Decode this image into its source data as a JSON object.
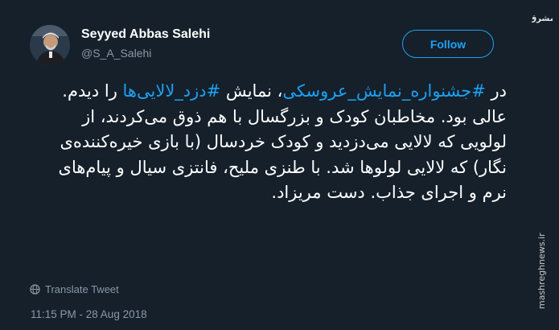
{
  "user": {
    "name": "Seyyed Abbas Salehi",
    "handle": "@S_A_Salehi"
  },
  "follow_button": {
    "label": "Follow"
  },
  "tweet": {
    "t1": "در ",
    "h1": "#جشنواره_نمایش_عروسکی",
    "t2": "، نمایش ",
    "h2": "#دزد_لالایی‌ها",
    "t3": " را دیدم. عالی بود. مخاطبان کودک و بزرگسال با هم ذوق می‌کردند، از لولویی که لالایی می‌دزدید و کودک خردسال (با بازی خیره‌کننده‌ی نگار) که  لالایی لولوها شد. با طنزی ملیح، فانتزی سیال و پیام‌های نرم و اجرای جذاب. دست مریزاد."
  },
  "translate_label": "Translate Tweet",
  "timestamp": "11:15 PM - 28 Aug 2018",
  "watermark": {
    "logo_text": "مشرق",
    "url_text": "mashreghnews.ir"
  },
  "colors": {
    "background": "#15202b",
    "accent": "#1da1f2",
    "muted_text": "#8899a6",
    "primary_text": "#ffffff"
  },
  "icons": {
    "translate": "globe-icon",
    "avatar": "profile-photo"
  }
}
